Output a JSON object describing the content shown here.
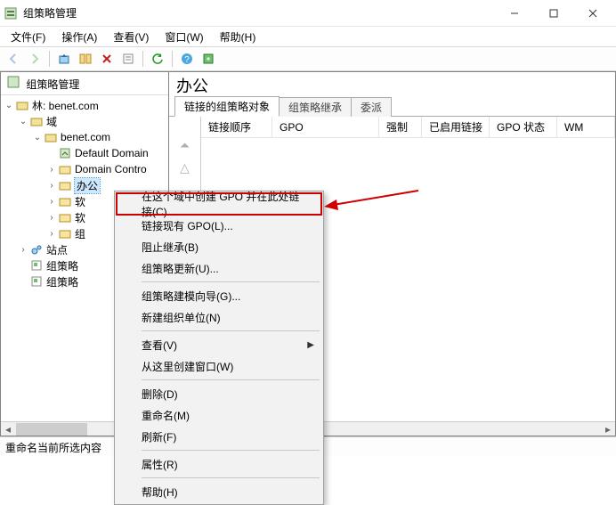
{
  "window": {
    "title": "组策略管理"
  },
  "menu": {
    "file": "文件(F)",
    "action": "操作(A)",
    "view": "查看(V)",
    "window": "窗口(W)",
    "help": "帮助(H)"
  },
  "tree": {
    "root": "组策略管理",
    "forest": "林: benet.com",
    "domains": "域",
    "domain": "benet.com",
    "items": {
      "default_domain": "Default Domain",
      "domain_controllers": "Domain Contro",
      "ou_bangong": "办公",
      "ou_x1": "软",
      "ou_x2": "软",
      "ou_x3": "组"
    },
    "sites": "站点",
    "gp_results_1": "组策略",
    "gp_results_2": "组策略"
  },
  "content": {
    "title": "办公",
    "tabs": {
      "linked": "链接的组策略对象",
      "inherit": "组策略继承",
      "delegate": "委派"
    },
    "columns": {
      "order": "链接顺序",
      "gpo": "GPO",
      "enforced": "强制",
      "enabled": "已启用链接",
      "status": "GPO 状态",
      "wmi": "WM"
    }
  },
  "context_menu": {
    "create_link": "在这个域中创建 GPO 并在此处链接(C)...",
    "link_existing": "链接现有 GPO(L)...",
    "block_inherit": "阻止继承(B)",
    "gp_update": "组策略更新(U)...",
    "modeling": "组策略建模向导(G)...",
    "new_ou": "新建组织单位(N)",
    "view": "查看(V)",
    "new_window": "从这里创建窗口(W)",
    "delete": "删除(D)",
    "rename": "重命名(M)",
    "refresh": "刷新(F)",
    "properties": "属性(R)",
    "help": "帮助(H)"
  },
  "status": {
    "text": "重命名当前所选内容"
  }
}
